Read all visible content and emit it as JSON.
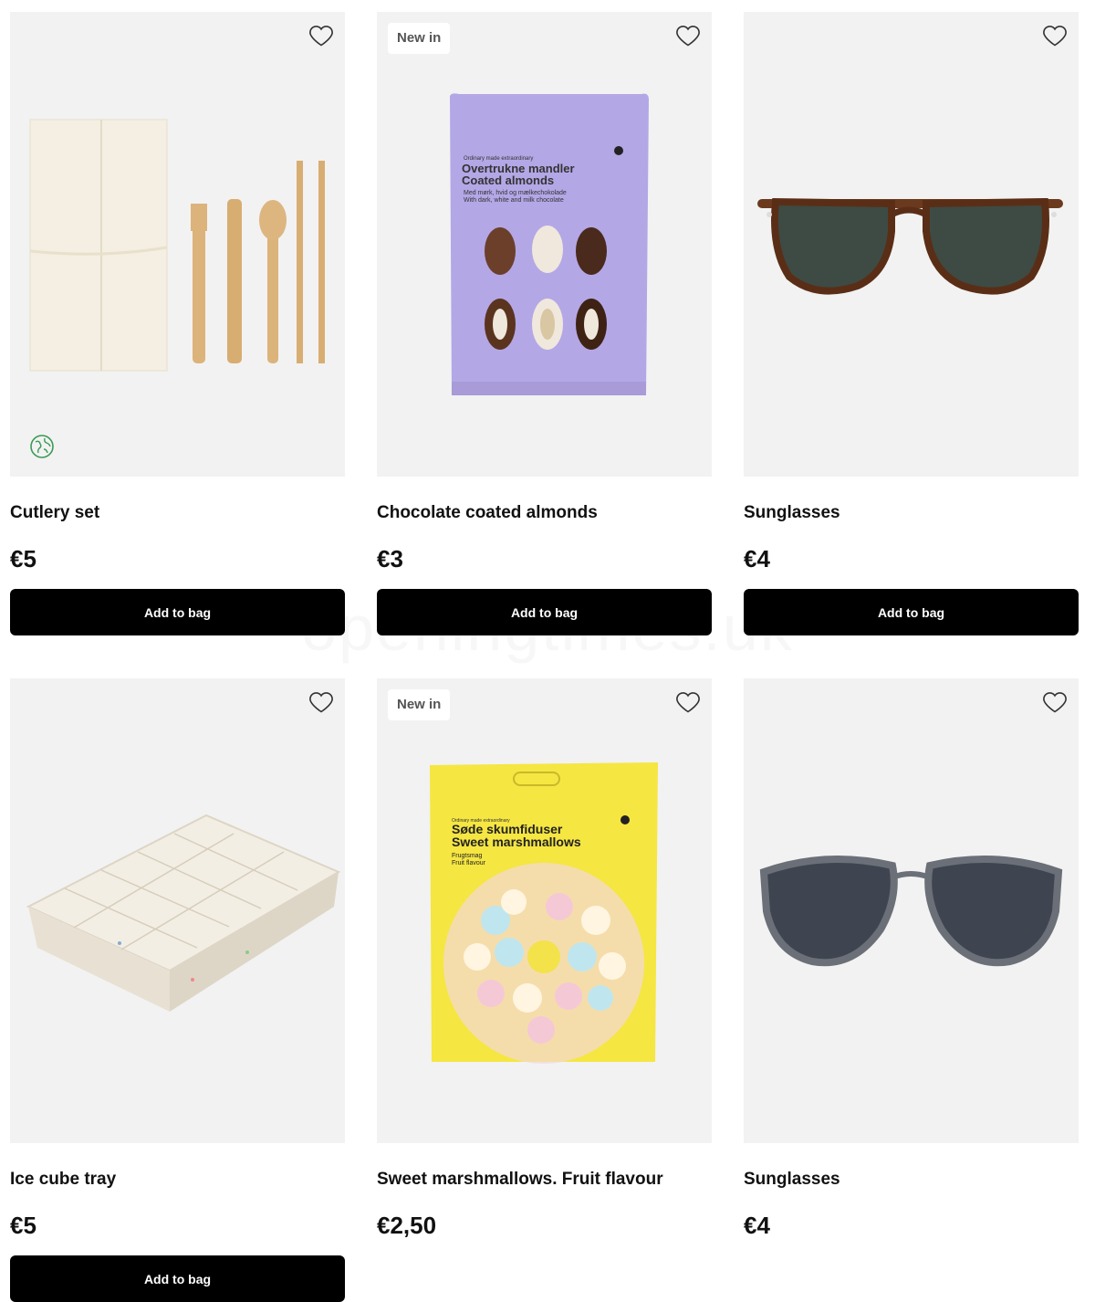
{
  "labels": {
    "add_to_bag": "Add to bag",
    "new_badge": "New in"
  },
  "watermark": "openingtimes.uk",
  "icons": {
    "wishlist": "heart-outline-icon",
    "eco": "earth-icon"
  },
  "colors": {
    "button_bg": "#000000",
    "image_bg": "#f2f2f2",
    "eco_green": "#3a9a55"
  },
  "products": [
    {
      "name": "Cutlery set",
      "price": "€5",
      "badge": "",
      "eco": true
    },
    {
      "name": "Chocolate coated almonds",
      "price": "€3",
      "badge": "New in",
      "eco": false,
      "package": {
        "line1": "Overtrukne mandler",
        "line2": "Coated almonds",
        "line3": "Med mørk, hvid og mælkechokolade",
        "line4": "With dark, white and milk chocolate",
        "tagline": "Ordinary made extraordinary"
      }
    },
    {
      "name": "Sunglasses",
      "price": "€4",
      "badge": "",
      "eco": false
    },
    {
      "name": "Ice cube tray",
      "price": "€5",
      "badge": "",
      "eco": false
    },
    {
      "name": "Sweet marshmallows. Fruit flavour",
      "price": "€2,50",
      "badge": "New in",
      "eco": false,
      "package": {
        "line1": "Søde skumfiduser",
        "line2": "Sweet marshmallows",
        "line3": "Frugtsmag",
        "line4": "Fruit flavour",
        "tagline": "Ordinary made extraordinary"
      }
    },
    {
      "name": "Sunglasses",
      "price": "€4",
      "badge": "",
      "eco": false
    }
  ]
}
